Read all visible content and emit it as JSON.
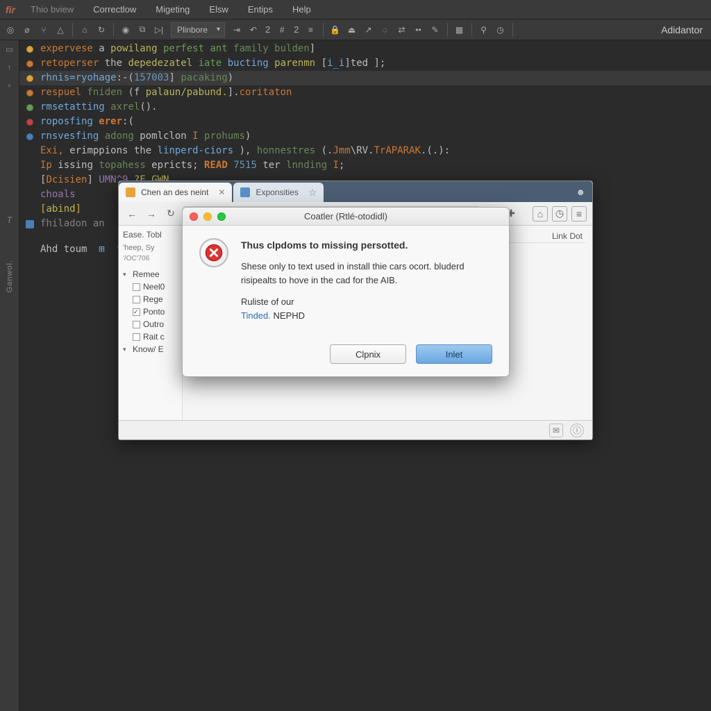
{
  "menubar": {
    "logo": "fir",
    "items": [
      {
        "label": "Thio bview",
        "muted": true
      },
      {
        "label": "Correctlow",
        "muted": false
      },
      {
        "label": "Migeting",
        "muted": false
      },
      {
        "label": "Elsw",
        "muted": false
      },
      {
        "label": "Entips",
        "muted": false
      },
      {
        "label": "Help",
        "muted": false
      }
    ]
  },
  "toolbar": {
    "select_label": "Plinbore",
    "num1": "2",
    "num2": "2",
    "right_label": "Adidantor"
  },
  "leftbar": {
    "label": "Ganwol."
  },
  "code": {
    "lines": [
      {
        "icon": "y",
        "tokens": [
          [
            "kw",
            "expervese "
          ],
          [
            "white",
            "a "
          ],
          [
            "prm",
            "powilang "
          ],
          [
            "mgr",
            "perfest ant "
          ],
          [
            "fn",
            "family bulden"
          ],
          [
            "white",
            "]"
          ]
        ]
      },
      {
        "icon": "o",
        "tokens": [
          [
            "kw",
            "retoperser "
          ],
          [
            "white",
            "the "
          ],
          [
            "prm",
            "depedezatel "
          ],
          [
            "mgr",
            "iate "
          ],
          [
            "blu",
            "bucting "
          ],
          [
            "prm",
            "parenmn "
          ],
          [
            "white",
            "["
          ],
          [
            "blu",
            "i_i"
          ],
          [
            "white",
            "]ted ];"
          ]
        ]
      },
      {
        "icon": "y",
        "hl": true,
        "tokens": [
          [
            "blu",
            "rhnis=ryohage"
          ],
          [
            "white",
            ":-("
          ],
          [
            "num",
            "157003"
          ],
          [
            "white",
            "] "
          ],
          [
            "fn",
            "pacaking"
          ],
          [
            "white",
            ")"
          ]
        ]
      },
      {
        "icon": "o",
        "tokens": [
          [
            "kw",
            "respuel "
          ],
          [
            "fn",
            "fniden "
          ],
          [
            "white",
            "(f "
          ],
          [
            "prm",
            "palaun/pabund."
          ],
          [
            "white",
            "]."
          ],
          [
            "kw",
            "coritaton"
          ]
        ]
      },
      {
        "icon": "g",
        "tokens": [
          [
            "blu",
            "rmsetatting "
          ],
          [
            "fn",
            "axrel"
          ],
          [
            "white",
            "()."
          ]
        ]
      },
      {
        "icon": "r",
        "tokens": [
          [
            "blu",
            "roposfing "
          ],
          [
            "err",
            "erer"
          ],
          [
            "white",
            ":("
          ]
        ]
      },
      {
        "icon": "b",
        "tokens": [
          [
            "blu",
            "rnsvesfing "
          ],
          [
            "fn",
            "adong "
          ],
          [
            "white",
            "pomlclon "
          ],
          [
            "kw",
            "I "
          ],
          [
            "fn",
            "prohums"
          ],
          [
            "white",
            ")"
          ]
        ]
      },
      {
        "icon": "",
        "tokens": [
          [
            "kw",
            "Exi, "
          ],
          [
            "white",
            "erimppions the "
          ],
          [
            "blu",
            "linperd-ciors "
          ],
          [
            "white",
            "), "
          ],
          [
            "fn",
            "honnestres "
          ],
          [
            "white",
            "(."
          ],
          [
            "kw",
            "Jmm"
          ],
          [
            "white",
            "\\RV."
          ],
          [
            "kw",
            "TrAPARAK"
          ],
          [
            "white",
            ".(.):"
          ]
        ]
      },
      {
        "icon": "",
        "tokens": [
          [
            "kw",
            "Ip "
          ],
          [
            "white",
            "issing "
          ],
          [
            "fn",
            "topahess "
          ],
          [
            "white",
            "epricts; "
          ],
          [
            "err",
            "READ "
          ],
          [
            "num",
            "7515"
          ],
          [
            "white",
            " ter "
          ],
          [
            "fn",
            "lnnding "
          ],
          [
            "kw",
            "I"
          ],
          [
            "white",
            ";"
          ]
        ]
      },
      {
        "icon": "",
        "tokens": [
          [
            "white",
            "["
          ],
          [
            "kw",
            "Dcisien"
          ],
          [
            "white",
            "] "
          ],
          [
            "var",
            "UMN^9"
          ],
          [
            "white",
            "."
          ],
          [
            "prm",
            "?E.GWN"
          ]
        ]
      },
      {
        "icon": "",
        "tokens": [
          [
            "var",
            "choals"
          ]
        ]
      },
      {
        "icon": "",
        "tokens": [
          [
            "bracket",
            "["
          ],
          [
            "prm",
            "abind"
          ],
          [
            "bracket",
            "]"
          ]
        ]
      },
      {
        "icon": "sq",
        "tokens": [
          [
            "com",
            "fhiladon an"
          ],
          [
            "white",
            "  "
          ]
        ]
      },
      {
        "icon": "",
        "tokens": [
          [
            "white",
            ""
          ]
        ]
      },
      {
        "icon": "",
        "tokens": [
          [
            "white",
            "Ahd toum  "
          ],
          [
            "blu",
            "⊞"
          ],
          [
            "white",
            "  f|"
          ]
        ]
      }
    ]
  },
  "browser": {
    "tabs": [
      {
        "label": "Chen an des neint",
        "active": true
      },
      {
        "label": "Exponsities",
        "active": false
      }
    ],
    "url_placeholder": "",
    "sidebar": {
      "crumb1": "Ease. Tobl",
      "crumb2": "'heep, Sy",
      "ts": "'/OC'706",
      "tree": [
        {
          "label": "Remee",
          "caret": true,
          "cb": false
        },
        {
          "label": "Neel0",
          "caret": false,
          "cb": true,
          "checked": false
        },
        {
          "label": "Rege",
          "caret": false,
          "cb": true,
          "checked": false
        },
        {
          "label": "Ponto",
          "caret": false,
          "cb": true,
          "checked": true
        },
        {
          "label": "Outro",
          "caret": false,
          "cb": true,
          "checked": false
        },
        {
          "label": "Rait c",
          "caret": false,
          "cb": true,
          "checked": false
        },
        {
          "label": "Know/ E",
          "caret": true,
          "cb": false
        }
      ]
    },
    "main": {
      "col1": "",
      "col2": "Link Dot"
    }
  },
  "dialog": {
    "title": "Coatler (Rtlé-otodidl)",
    "heading": "Thus clpdoms to missing persotted.",
    "para1": "Shese only to text used in install thie cars ocort. bluderd risipealts to hove in the cad for the AIB.",
    "para2a": "Ruliste of our",
    "link": "Tinded.",
    "para2b": "NEPHD",
    "btn_cancel": "Clpnix",
    "btn_ok": "Inlet"
  }
}
